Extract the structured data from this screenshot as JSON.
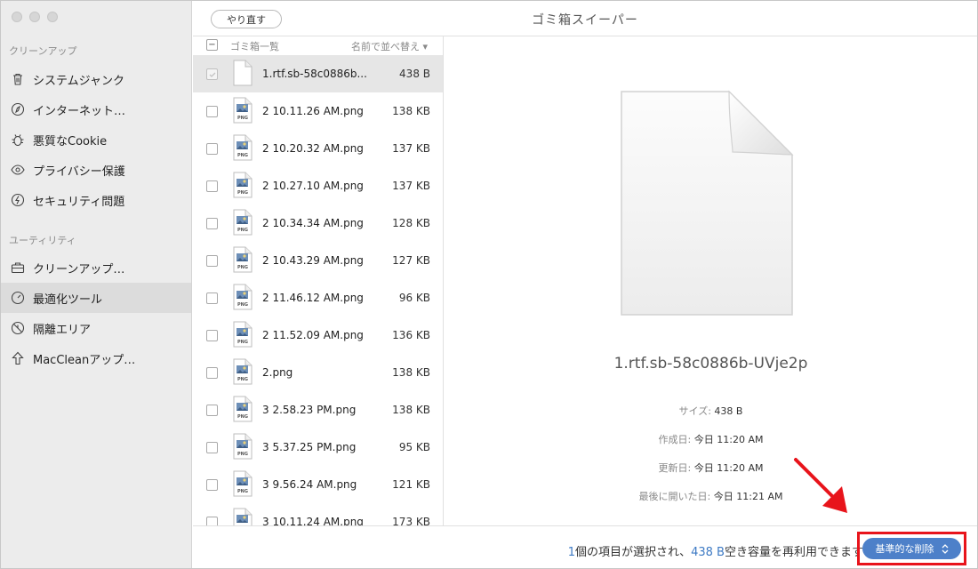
{
  "window": {
    "title": "ゴミ箱スイーパー",
    "undo_label": "やり直す"
  },
  "sidebar": {
    "section_cleanup": "クリーンアップ",
    "cleanup_items": [
      {
        "label": "システムジャンク",
        "icon": "trash-icon"
      },
      {
        "label": "インターネット…",
        "icon": "compass-icon"
      },
      {
        "label": "悪質なCookie",
        "icon": "bug-icon"
      },
      {
        "label": "プライバシー保護",
        "icon": "eye-icon"
      },
      {
        "label": "セキュリティ問題",
        "icon": "shield-icon"
      }
    ],
    "section_utility": "ユーティリティ",
    "utility_items": [
      {
        "label": "クリーンアップ…",
        "icon": "briefcase-icon"
      },
      {
        "label": "最適化ツール",
        "icon": "gauge-icon",
        "active": true
      },
      {
        "label": "隔離エリア",
        "icon": "quarantine-icon"
      },
      {
        "label": "MacCleanアップ…",
        "icon": "arrow-up-icon"
      }
    ]
  },
  "list": {
    "header_label": "ゴミ箱一覧",
    "sort_label": "名前で並べ替え",
    "files": [
      {
        "name": "1.rtf.sb-58c0886b...",
        "size": "438 B",
        "type": "doc",
        "selected": true
      },
      {
        "name": "2 10.11.26 AM.png",
        "size": "138 KB",
        "type": "png"
      },
      {
        "name": "2 10.20.32 AM.png",
        "size": "137 KB",
        "type": "png"
      },
      {
        "name": "2 10.27.10 AM.png",
        "size": "137 KB",
        "type": "png"
      },
      {
        "name": "2 10.34.34 AM.png",
        "size": "128 KB",
        "type": "png"
      },
      {
        "name": "2 10.43.29 AM.png",
        "size": "127 KB",
        "type": "png"
      },
      {
        "name": "2 11.46.12 AM.png",
        "size": "96 KB",
        "type": "png"
      },
      {
        "name": "2 11.52.09 AM.png",
        "size": "136 KB",
        "type": "png"
      },
      {
        "name": "2.png",
        "size": "138 KB",
        "type": "png"
      },
      {
        "name": "3 2.58.23 PM.png",
        "size": "138 KB",
        "type": "png"
      },
      {
        "name": "3 5.37.25 PM.png",
        "size": "95 KB",
        "type": "png"
      },
      {
        "name": "3 9.56.24 AM.png",
        "size": "121 KB",
        "type": "png"
      },
      {
        "name": "3 10.11.24 AM.png",
        "size": "173 KB",
        "type": "png"
      }
    ]
  },
  "preview": {
    "filename": "1.rtf.sb-58c0886b-UVje2p",
    "size_key": "サイズ:",
    "size_val": "438 B",
    "created_key": "作成日:",
    "created_val": "今日 11:20 AM",
    "modified_key": "更新日:",
    "modified_val": "今日 11:20 AM",
    "opened_key": "最後に開いた日:",
    "opened_val": "今日 11:21 AM"
  },
  "footer": {
    "count": "1",
    "text1": "個の項目が選択され、",
    "size": "438 B",
    "text2": "空き容量を再利用できます",
    "button_label": "基準的な削除"
  },
  "colors": {
    "accent": "#4d80c9",
    "highlight_frame": "#e8141b",
    "arrow": "#e8141b"
  }
}
